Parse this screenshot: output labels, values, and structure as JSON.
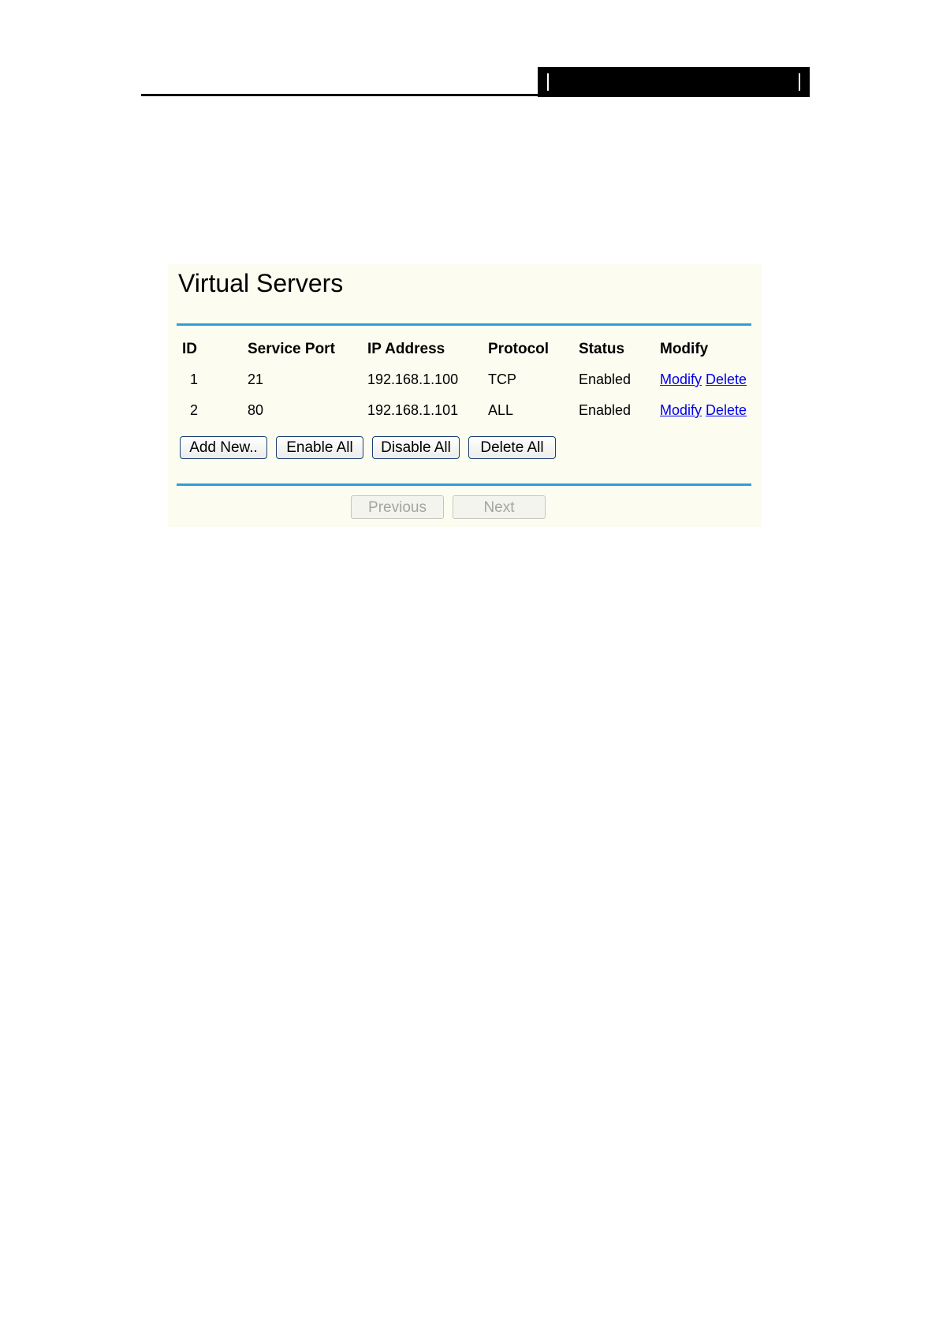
{
  "page": {
    "title": "Virtual Servers"
  },
  "table": {
    "headers": {
      "id": "ID",
      "service_port": "Service Port",
      "ip_address": "IP Address",
      "protocol": "Protocol",
      "status": "Status",
      "modify": "Modify"
    },
    "rows": [
      {
        "id": "1",
        "service_port": "21",
        "ip_address": "192.168.1.100",
        "protocol": "TCP",
        "status": "Enabled",
        "modify_label": "Modify",
        "delete_label": "Delete"
      },
      {
        "id": "2",
        "service_port": "80",
        "ip_address": "192.168.1.101",
        "protocol": "ALL",
        "status": "Enabled",
        "modify_label": "Modify",
        "delete_label": "Delete"
      }
    ]
  },
  "actions": {
    "add_new": "Add New..",
    "enable_all": "Enable All",
    "disable_all": "Disable All",
    "delete_all": "Delete All"
  },
  "pagination": {
    "previous": "Previous",
    "next": "Next",
    "previous_enabled": false,
    "next_enabled": false
  },
  "colors": {
    "panel_background": "#fcfcf0",
    "rule": "#2e9ed6",
    "link": "#0000ee",
    "disabled_text": "#a4a4a4"
  }
}
